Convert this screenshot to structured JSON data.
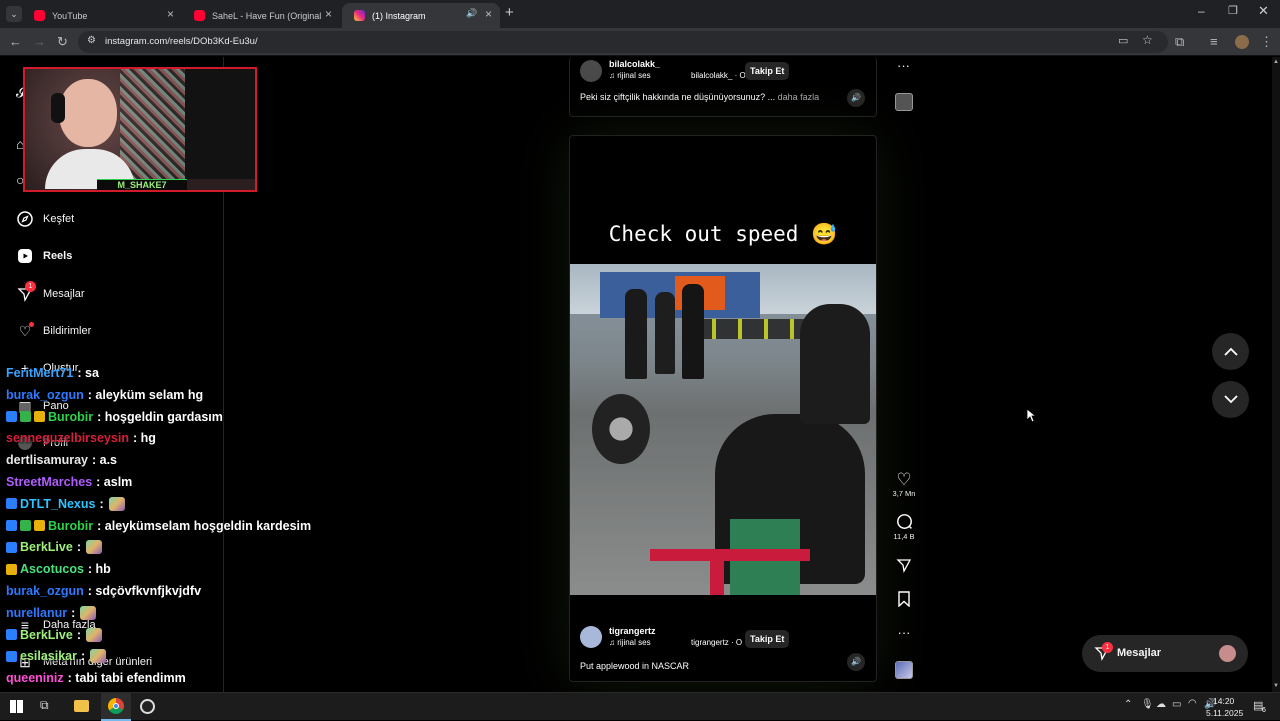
{
  "browser": {
    "tabs": [
      {
        "label": "YouTube",
        "color": "#ff0033"
      },
      {
        "label": "SaheL - Have Fun (Original Mix)",
        "color": "#ff0033"
      },
      {
        "label": "(1) Instagram",
        "color": "#e1306c"
      }
    ],
    "url": "instagram.com/reels/DOb3Kd-Eu3u/"
  },
  "stream": {
    "overlay_name": "M_SHAKE7"
  },
  "sidebar": {
    "items": [
      {
        "label": "Keşfet",
        "icon": "compass-icon"
      },
      {
        "label": "Reels",
        "icon": "reels-icon"
      },
      {
        "label": "Mesajlar",
        "icon": "send-icon",
        "badge": "1"
      },
      {
        "label": "Bildirimler",
        "icon": "heart-icon"
      },
      {
        "label": "Oluştur",
        "icon": "plus-icon"
      },
      {
        "label": "Pano",
        "icon": "dashboard-icon"
      },
      {
        "label": "Profil",
        "icon": "profile-icon"
      },
      {
        "label": "Daha fazla",
        "icon": "menu-icon"
      },
      {
        "label": "Meta'nın diğer ürünleri",
        "icon": "meta-icon"
      }
    ]
  },
  "chat": [
    {
      "user": "FeritMert71",
      "msg": ": sa",
      "color": "#3aa3ff"
    },
    {
      "user": "burak_ozgun",
      "msg": ": aleyküm selam hg",
      "color": "#2e79ff"
    },
    {
      "user": "Burobir",
      "msg": ": hoşgeldin gardasım",
      "color": "#2bd24a",
      "badges": [
        "#2a7fff",
        "#35b24a",
        "#e8b00a"
      ]
    },
    {
      "user": "senneguzelbirseysin",
      "msg": ": hg",
      "color": "#d61f3a"
    },
    {
      "user": "dertlisamuray",
      "msg": ": a.s",
      "color": "#e8e8e8"
    },
    {
      "user": "StreetMarches",
      "msg": ": aslm",
      "color": "#b05cff"
    },
    {
      "user": "DTLT_Nexus",
      "msg": ":",
      "color": "#2ec4ff",
      "badges": [
        "#2a7fff"
      ],
      "emote": true
    },
    {
      "user": "Burobir",
      "msg": ": aleykümselam hoşgeldin kardesim",
      "color": "#2bd24a",
      "badges": [
        "#2a7fff",
        "#35b24a",
        "#e8b00a"
      ]
    },
    {
      "user": "BerkLive",
      "msg": ":",
      "color": "#9ef07a",
      "badges": [
        "#2a7fff"
      ],
      "emote": true
    },
    {
      "user": "Ascotucos",
      "msg": ": hb",
      "color": "#4be07b",
      "badges": [
        "#e8b00a"
      ]
    },
    {
      "user": "burak_ozgun",
      "msg": ": sdçövfkvnfjkvjdfv",
      "color": "#2e79ff"
    },
    {
      "user": "nurellanur",
      "msg": ":",
      "color": "#2e79ff",
      "emote": true
    },
    {
      "user": "BerkLive",
      "msg": ":",
      "color": "#9ef07a",
      "badges": [
        "#2a7fff"
      ],
      "emote": true
    },
    {
      "user": "esilasikar",
      "msg": ":",
      "color": "#9ef07a",
      "badges": [
        "#2a7fff"
      ],
      "emote": true
    },
    {
      "user": "queeniniz",
      "msg": ": tabi tabi efendimm",
      "color": "#ff4fd6"
    }
  ],
  "reel_top": {
    "username": "bilalcolakk_",
    "audio": "rijinal ses",
    "audio_author": "bilalcolakk_ · O",
    "follow": "Takip Et",
    "caption": "Peki siz çiftçilik hakkında ne düşünüyorsunuz? ...",
    "more": "daha fazla"
  },
  "reel_main": {
    "overlay_text": "Check out speed 😅",
    "username": "tigrangertz",
    "audio": "rijinal ses",
    "audio_author": "tigrangertz · O",
    "follow": "Takip Et",
    "caption": "Put applewood in NASCAR",
    "likes": "3,7 Mn",
    "comments": "11,4 B"
  },
  "messages_widget": {
    "label": "Mesajlar",
    "badge": "1"
  },
  "taskbar": {
    "time": "14:20",
    "date": "5.11.2025",
    "notif": "6"
  }
}
